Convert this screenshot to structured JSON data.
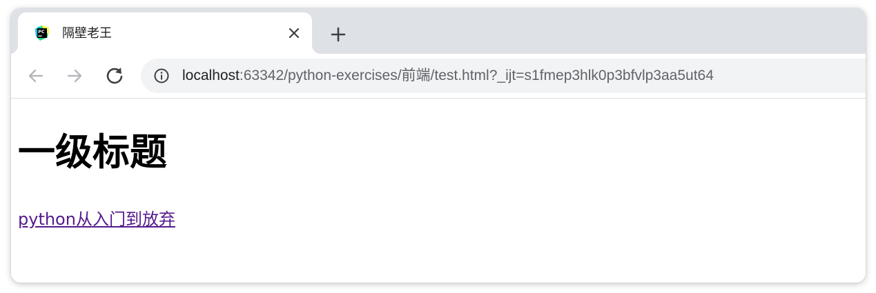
{
  "browser": {
    "tab": {
      "title": "隔壁老王",
      "favicon": "pycharm-icon"
    },
    "new_tab_icon": "plus-icon",
    "close_icon": "close-icon",
    "nav": {
      "back_icon": "arrow-left-icon",
      "forward_icon": "arrow-right-icon",
      "reload_icon": "reload-icon"
    },
    "address_bar": {
      "info_icon": "info-icon",
      "host": "localhost",
      "rest": ":63342/python-exercises/前端/test.html?_ijt=s1fmep3hlk0p3bfvlp3aa5ut64"
    }
  },
  "page": {
    "heading": "一级标题",
    "link_text": "python从入门到放弃"
  },
  "colors": {
    "tabstrip": "#dee1e6",
    "omnibox": "#f1f3f4",
    "visited_link": "#551a8b"
  }
}
